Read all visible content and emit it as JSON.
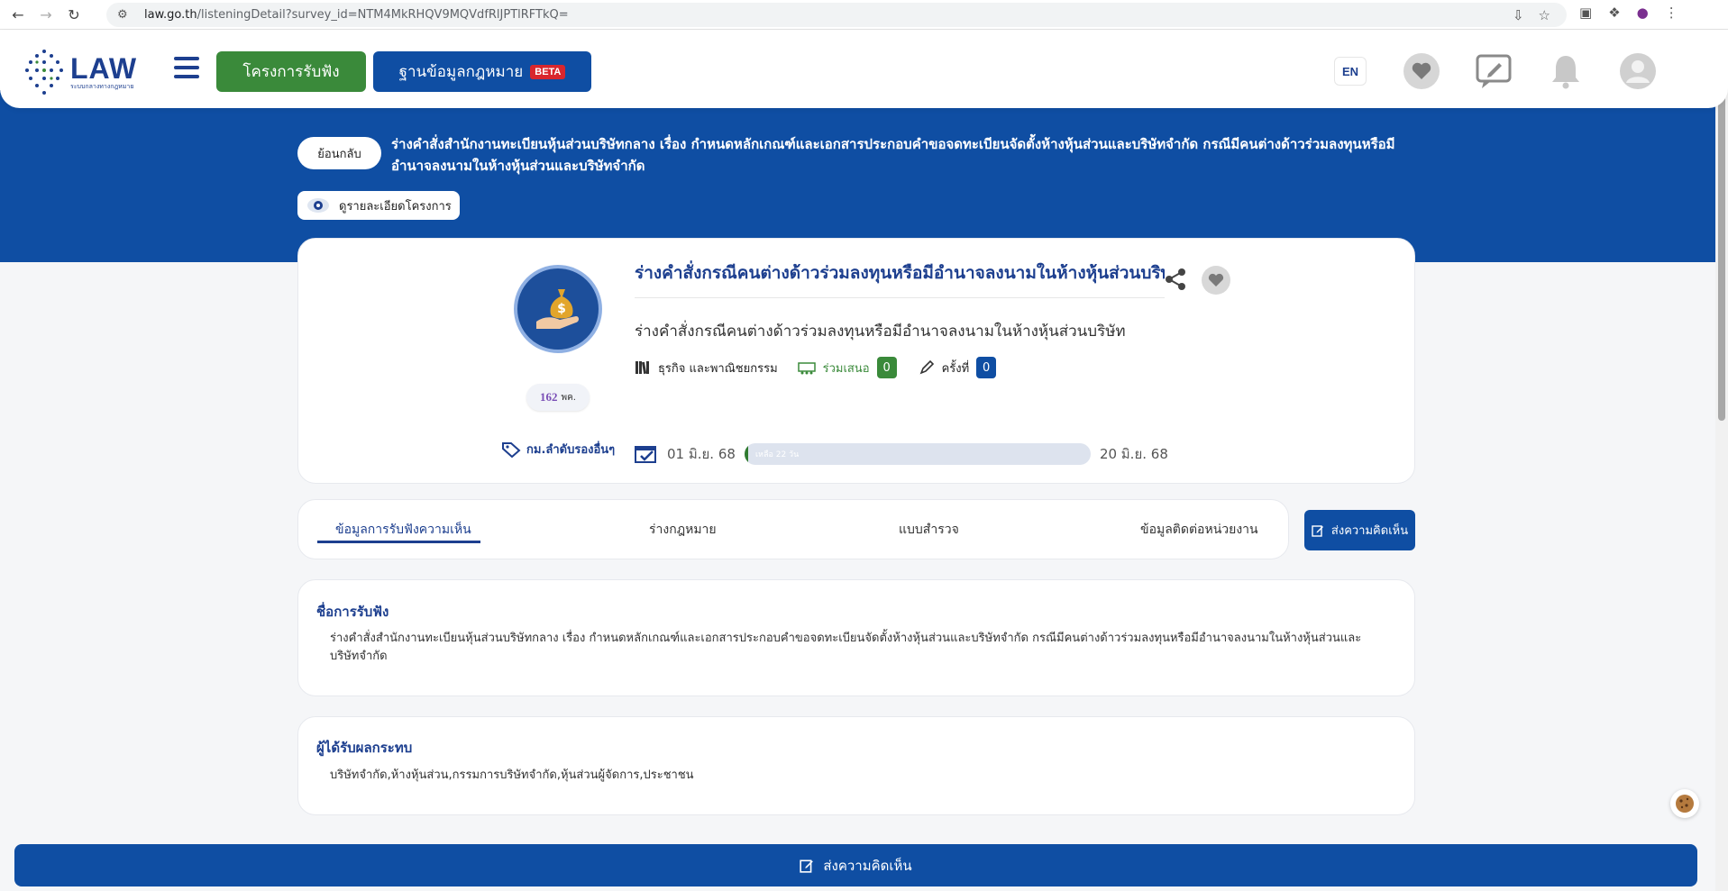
{
  "browser": {
    "url_host": "law.go.th",
    "url_path": "/listeningDetail?survey_id=NTM4MkRHQV9MQVdfRlJPTlRFTkQ="
  },
  "header": {
    "logo_text": "LAW",
    "logo_subtext": "ระบบกลางทางกฎหมาย",
    "nav_primary": "โครงการรับฟัง",
    "nav_secondary": "ฐานข้อมูลกฎหมาย",
    "beta_label": "BETA",
    "lang": "EN"
  },
  "banner": {
    "back_label": "ย้อนกลับ",
    "title": "ร่างคำสั่งสำนักงานทะเบียนหุ้นส่วนบริษัทกลาง เรื่อง กำหนดหลักเกณฑ์และเอกสารประกอบคำขอจดทะเบียนจัดตั้งห้างหุ้นส่วนและบริษัทจำกัด กรณีมีคนต่างด้าวร่วมลงทุนหรือมีอำนาจลงนามในห้างหุ้นส่วนและบริษัทจำกัด",
    "detail_label": "ดูรายละเอียดโครงการ"
  },
  "subject": {
    "title": "ร่างคำสั่งกรณีคนต่างด้าวร่วมลงทุนหรือมีอำนาจลงนามในห้างหุ้นส่วนบริษัท",
    "description": "ร่างคำสั่งกรณีคนต่างด้าวร่วมลงทุนหรือมีอำนาจลงนามในห้างหุ้นส่วนบริษัท",
    "category": "ธุรกิจ และพาณิชยกรรม",
    "join_label": "ร่วมเสนอ",
    "join_count": "0",
    "times_label": "ครั้งที่",
    "times_count": "0",
    "badge_number": "162",
    "badge_suffix": "พค.",
    "tag_label": "กม.ลำดับรองอื่นๆ",
    "start_date": "01 มิ.ย. 68",
    "end_date": "20 มิ.ย. 68",
    "remaining_label": "เหลือ 22 วัน",
    "progress_fraction": 0.01
  },
  "tabs": [
    {
      "label": "ข้อมูลการรับฟังความเห็น"
    },
    {
      "label": "ร่างกฎหมาย"
    },
    {
      "label": "แบบสำรวจ"
    },
    {
      "label": "ข้อมูลติดต่อหน่วยงาน"
    }
  ],
  "send_comment_label": "ส่งความคิดเห็น",
  "sections": {
    "hearing_name": {
      "title": "ชื่อการรับฟัง",
      "body": "ร่างคำสั่งสำนักงานทะเบียนหุ้นส่วนบริษัทกลาง  เรื่อง กำหนดหลักเกณฑ์และเอกสารประกอบคำขอจดทะเบียนจัดตั้งห้างหุ้นส่วนและบริษัทจำกัด  กรณีมีคนต่างด้าวร่วมลงทุนหรือมีอำนาจลงนามในห้างหุ้นส่วนและบริษัทจำกัด"
    },
    "affected": {
      "title": "ผู้ได้รับผลกระทบ",
      "body": "บริษัทจำกัด,ห้างหุ้นส่วน,กรรมการบริษัทจำกัด,หุ้นส่วนผู้จัดการ,ประชาชน"
    }
  },
  "colors": {
    "brand_blue": "#0f4ea3",
    "brand_green": "#3a8a3a",
    "title_blue": "#1d3f8f"
  }
}
